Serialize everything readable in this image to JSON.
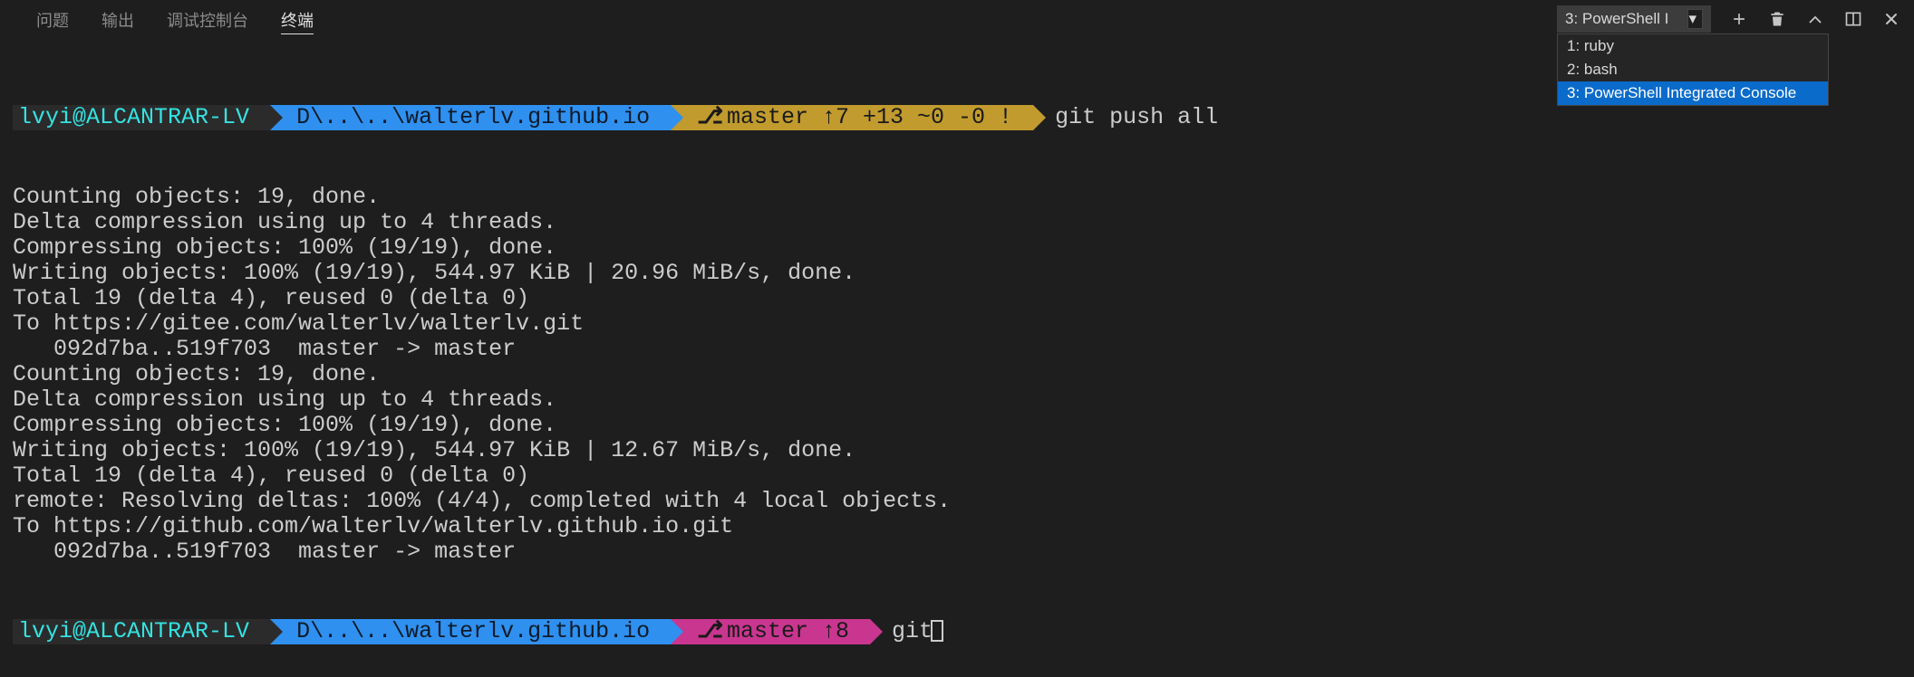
{
  "tabs": {
    "problems": "问题",
    "output": "输出",
    "debugConsole": "调试控制台",
    "terminal": "终端"
  },
  "terminalSelector": {
    "current": "3: PowerShell I",
    "options": [
      "1: ruby",
      "2: bash",
      "3: PowerShell Integrated Console"
    ]
  },
  "prompt1": {
    "user": "lvyi@ALCANTRAR-LV",
    "path": "D\\..\\..\\walterlv.github.io",
    "git": "master ↑7 +13 ~0 -0 !",
    "cmd": "git push all"
  },
  "outputLines": [
    "Counting objects: 19, done.",
    "Delta compression using up to 4 threads.",
    "Compressing objects: 100% (19/19), done.",
    "Writing objects: 100% (19/19), 544.97 KiB | 20.96 MiB/s, done.",
    "Total 19 (delta 4), reused 0 (delta 0)",
    "To https://gitee.com/walterlv/walterlv.git",
    "   092d7ba..519f703  master -> master",
    "Counting objects: 19, done.",
    "Delta compression using up to 4 threads.",
    "Compressing objects: 100% (19/19), done.",
    "Writing objects: 100% (19/19), 544.97 KiB | 12.67 MiB/s, done.",
    "Total 19 (delta 4), reused 0 (delta 0)",
    "remote: Resolving deltas: 100% (4/4), completed with 4 local objects.",
    "To https://github.com/walterlv/walterlv.github.io.git",
    "   092d7ba..519f703  master -> master"
  ],
  "prompt2": {
    "user": "lvyi@ALCANTRAR-LV",
    "path": "D\\..\\..\\walterlv.github.io",
    "git": "master ↑8",
    "cmd": "git"
  },
  "icons": {
    "branch": "⎇"
  }
}
